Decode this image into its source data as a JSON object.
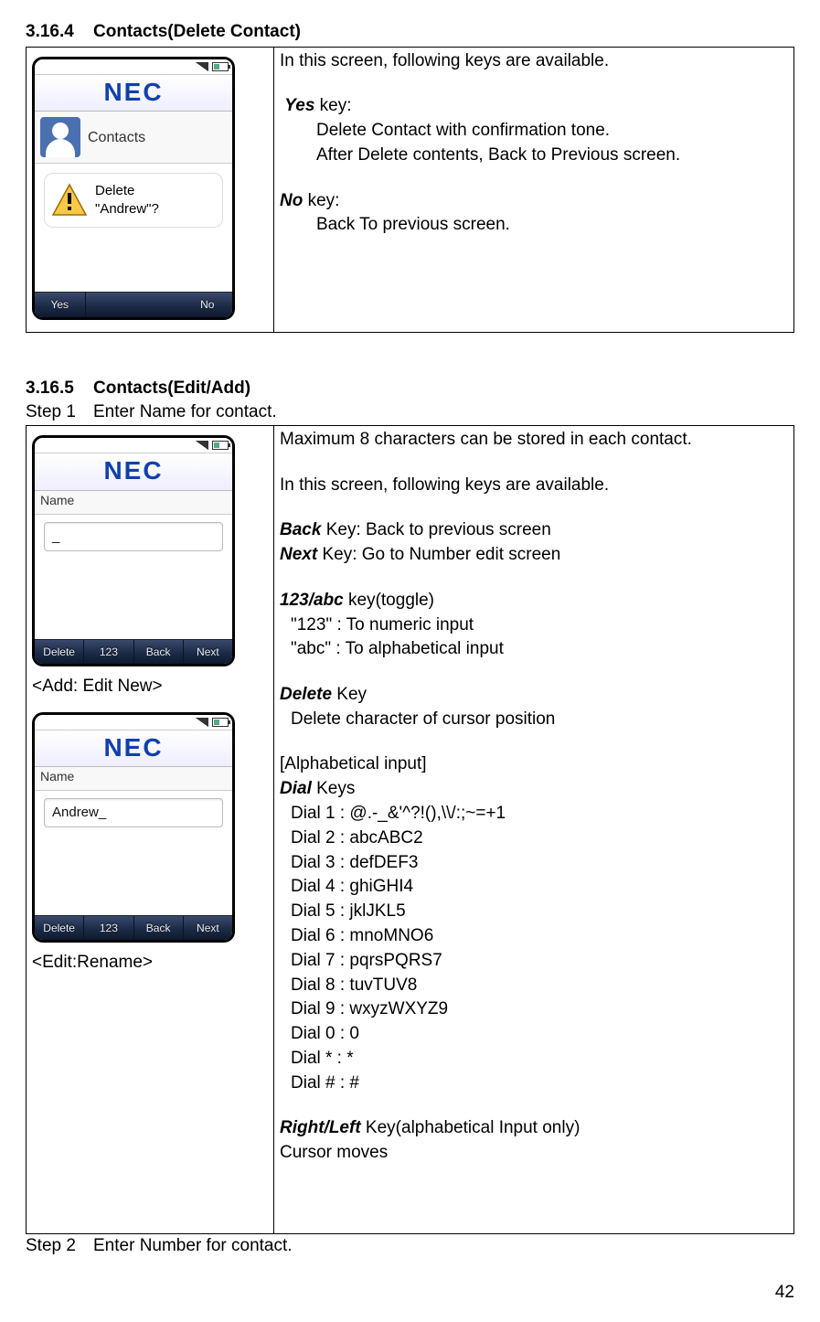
{
  "section1": {
    "num": "3.16.4",
    "title": "Contacts(Delete Contact)",
    "screenshot": {
      "brand": "NEC",
      "title_label": "Contacts",
      "dialog_line1": "Delete",
      "dialog_line2": "\"Andrew\"?",
      "softkey_left": "Yes",
      "softkey_right": "No"
    },
    "desc_intro": "In this screen, following keys are available.",
    "yes_label": "Yes",
    "yes_key_suffix": " key:",
    "yes_line1": "Delete Contact with confirmation tone.",
    "yes_line2": "After Delete contents, Back to Previous screen.",
    "no_label": "No",
    "no_key_suffix": " key:",
    "no_line1": "Back To previous screen."
  },
  "section2": {
    "num": "3.16.5",
    "title": "Contacts(Edit/Add)",
    "step1_num": "Step 1",
    "step1_title": "Enter Name for contact.",
    "screenshot1": {
      "brand": "NEC",
      "label": "Name",
      "value": "_",
      "sk_delete": "Delete",
      "sk_123": "123",
      "sk_back": "Back",
      "sk_next": "Next",
      "caption": "<Add: Edit New>"
    },
    "screenshot2": {
      "brand": "NEC",
      "label": "Name",
      "value": "Andrew_",
      "sk_delete": "Delete",
      "sk_123": "123",
      "sk_back": "Back",
      "sk_next": "Next",
      "caption": "<Edit:Rename>"
    },
    "right": {
      "l1": "Maximum 8 characters can be stored in each contact.",
      "l2": "In this screen, following keys are available.",
      "back_key_b": "Back",
      "back_key_suffix": " Key:    Back to previous screen",
      "next_key_b": "Next",
      "next_key_suffix": " Key:     Go to Number edit screen",
      "toggle_b": "123/abc",
      "toggle_suffix": " key(toggle)",
      "toggle_123": "\"123\" : To numeric input",
      "toggle_abc": "\"abc\" : To alphabetical input",
      "delete_key_b": "Delete",
      "delete_key_suffix": " Key",
      "delete_desc": "Delete character of cursor position",
      "alpha_head": "[Alphabetical input]",
      "dial_b": "Dial",
      "dial_suffix": " Keys",
      "dial1": "Dial 1 : @.-_&'^?!(),\\\\/:;~=+1",
      "dial2": "Dial 2 : abcABC2",
      "dial3": "Dial 3 : defDEF3",
      "dial4": "Dial 4 : ghiGHI4",
      "dial5": "Dial 5 : jklJKL5",
      "dial6": "Dial 6 : mnoMNO6",
      "dial7": "Dial 7 : pqrsPQRS7",
      "dial8": "Dial 8 : tuvTUV8",
      "dial9": "Dial 9 : wxyzWXYZ9",
      "dial0": "Dial 0 : 0",
      "dialstar": "Dial * : *",
      "dialhash": "Dial # : #",
      "rl_b": "Right/Left",
      "rl_suffix": " Key(alphabetical Input only)",
      "rl_desc": "Cursor moves"
    },
    "step2_num": "Step 2",
    "step2_title": "Enter Number for contact."
  },
  "page_number": "42"
}
